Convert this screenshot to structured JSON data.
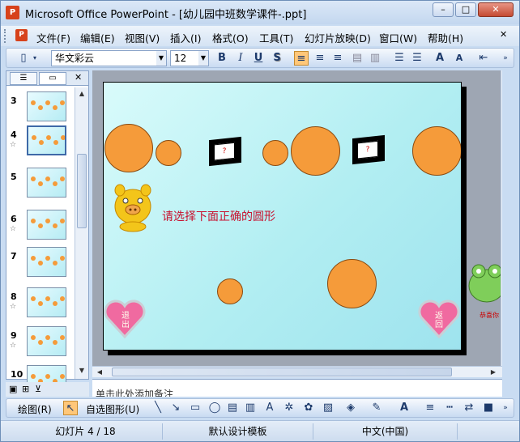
{
  "window": {
    "title": "Microsoft Office PowerPoint - [幼儿园中班数学课件-.ppt]",
    "app_icon": "P",
    "controls": {
      "minimize": "–",
      "maximize": "□",
      "close": "✕"
    }
  },
  "menu": {
    "items": [
      "文件(F)",
      "编辑(E)",
      "视图(V)",
      "插入(I)",
      "格式(O)",
      "工具(T)",
      "幻灯片放映(D)",
      "窗口(W)",
      "帮助(H)"
    ],
    "doc_close": "✕"
  },
  "toolbar": {
    "font_name": "华文彩云",
    "font_size": "12",
    "bold": "B",
    "italic": "I",
    "underline": "U",
    "shadow": "S",
    "grow_font": "A",
    "shrink_font": "A"
  },
  "thumbnails": {
    "slides": [
      {
        "num": "3",
        "star": false
      },
      {
        "num": "4",
        "star": true,
        "selected": true
      },
      {
        "num": "5",
        "star": false
      },
      {
        "num": "6",
        "star": true
      },
      {
        "num": "7",
        "star": false
      },
      {
        "num": "8",
        "star": true
      },
      {
        "num": "9",
        "star": true
      },
      {
        "num": "10",
        "star": false
      }
    ],
    "close": "✕",
    "star_glyph": "☆"
  },
  "slide": {
    "prompt": "请选择下面正确的圆形",
    "question_mark": "?",
    "heart_left": "退出",
    "heart_right": "返回",
    "frog_caption": "恭喜你"
  },
  "notes": {
    "placeholder": "单击此处添加备注"
  },
  "drawing": {
    "draw_menu": "绘图(R)",
    "autoshapes": "自选图形(U)"
  },
  "status": {
    "slide_info": "幻灯片 4 / 18",
    "template": "默认设计模板",
    "language": "中文(中国)"
  },
  "colors": {
    "circle": "#f59b3a",
    "prompt": "#c8102e",
    "heart": "#f06aa0"
  }
}
